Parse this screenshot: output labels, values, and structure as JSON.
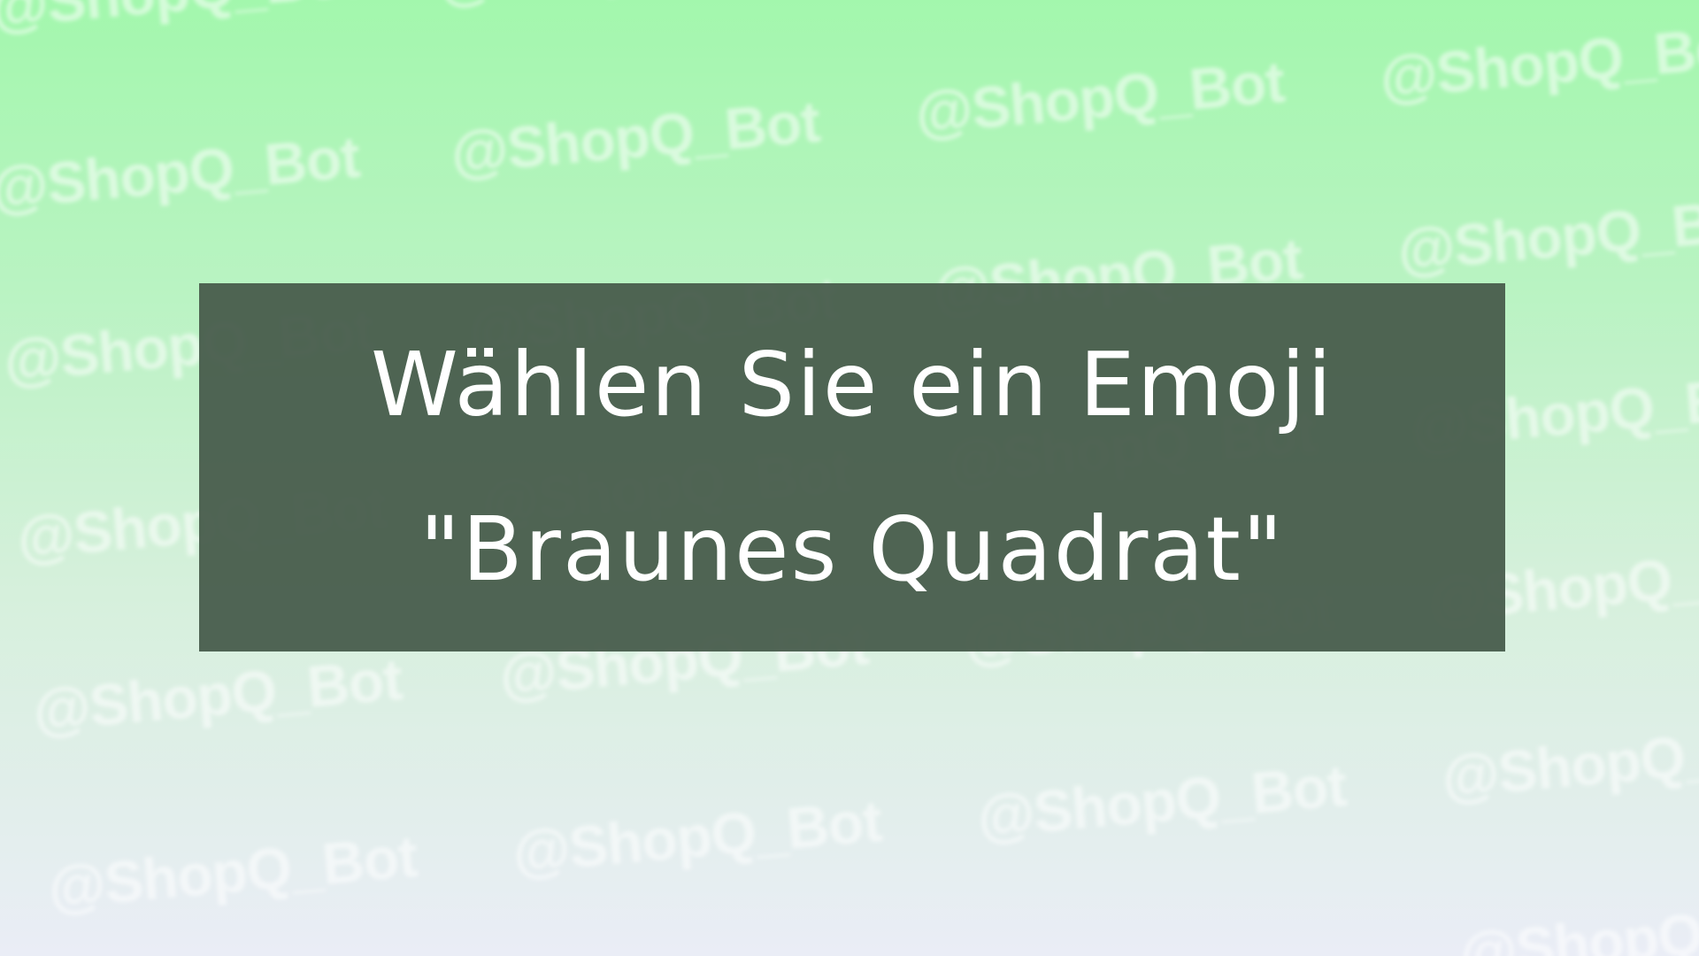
{
  "background": {
    "gradient_top": "#a3f7ad",
    "gradient_bottom": "#eaedf6",
    "watermark_text": "@ShopQ_Bot"
  },
  "banner": {
    "line1": "Wählen Sie ein Emoji",
    "line2": "\"Braunes Quadrat\"",
    "background_color": "#4b624f",
    "text_color": "#ffffff"
  }
}
